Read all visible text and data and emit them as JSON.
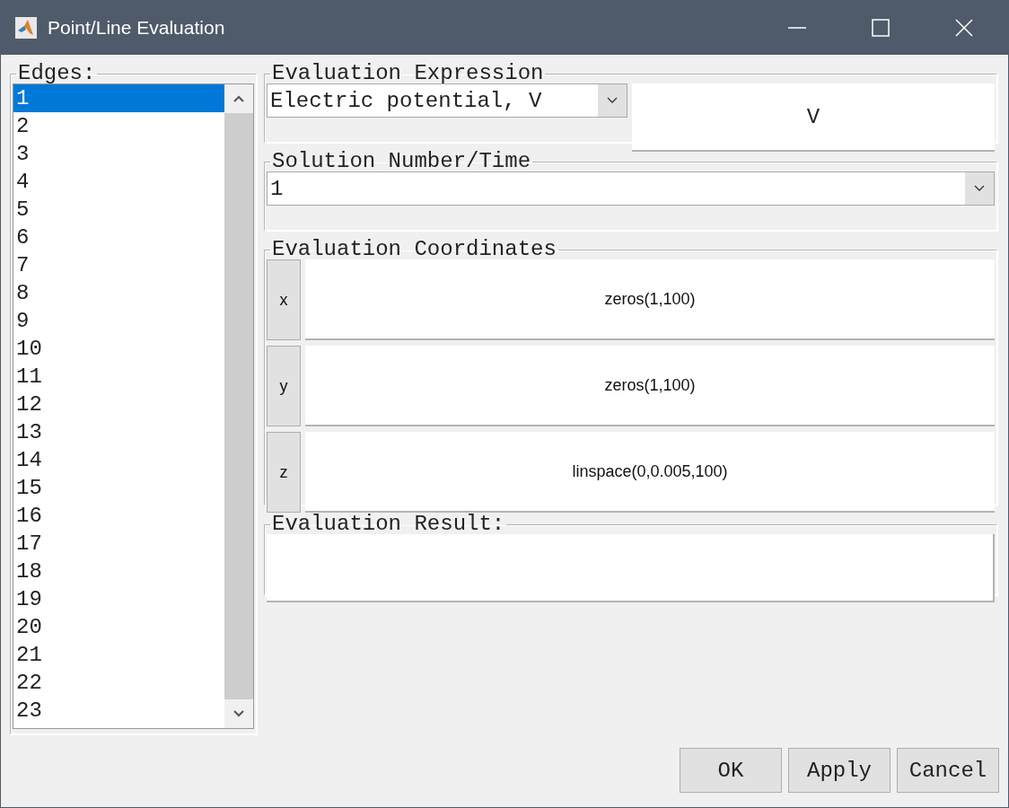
{
  "window": {
    "title": "Point/Line Evaluation"
  },
  "edges": {
    "label": "Edges:",
    "items": [
      {
        "label": "1",
        "selected": true
      },
      {
        "label": "2",
        "selected": false
      },
      {
        "label": "3",
        "selected": false
      },
      {
        "label": "4",
        "selected": false
      },
      {
        "label": "5",
        "selected": false
      },
      {
        "label": "6",
        "selected": false
      },
      {
        "label": "7",
        "selected": false
      },
      {
        "label": "8",
        "selected": false
      },
      {
        "label": "9",
        "selected": false
      },
      {
        "label": "10",
        "selected": false
      },
      {
        "label": "11",
        "selected": false
      },
      {
        "label": "12",
        "selected": false
      },
      {
        "label": "13",
        "selected": false
      },
      {
        "label": "14",
        "selected": false
      },
      {
        "label": "15",
        "selected": false
      },
      {
        "label": "16",
        "selected": false
      },
      {
        "label": "17",
        "selected": false
      },
      {
        "label": "18",
        "selected": false
      },
      {
        "label": "19",
        "selected": false
      },
      {
        "label": "20",
        "selected": false
      },
      {
        "label": "21",
        "selected": false
      },
      {
        "label": "22",
        "selected": false
      },
      {
        "label": "23",
        "selected": false
      }
    ]
  },
  "evaluation_expression": {
    "label": "Evaluation Expression",
    "value": "Electric potential, V",
    "unit": "V"
  },
  "solution": {
    "label": "Solution Number/Time",
    "value": "1"
  },
  "coordinates": {
    "label": "Evaluation Coordinates",
    "rows": [
      {
        "axis": "x",
        "value": "zeros(1,100)"
      },
      {
        "axis": "y",
        "value": "zeros(1,100)"
      },
      {
        "axis": "z",
        "value": "linspace(0,0.005,100)"
      }
    ]
  },
  "result": {
    "label": "Evaluation Result:"
  },
  "buttons": [
    "OK",
    "Apply",
    "Cancel"
  ]
}
